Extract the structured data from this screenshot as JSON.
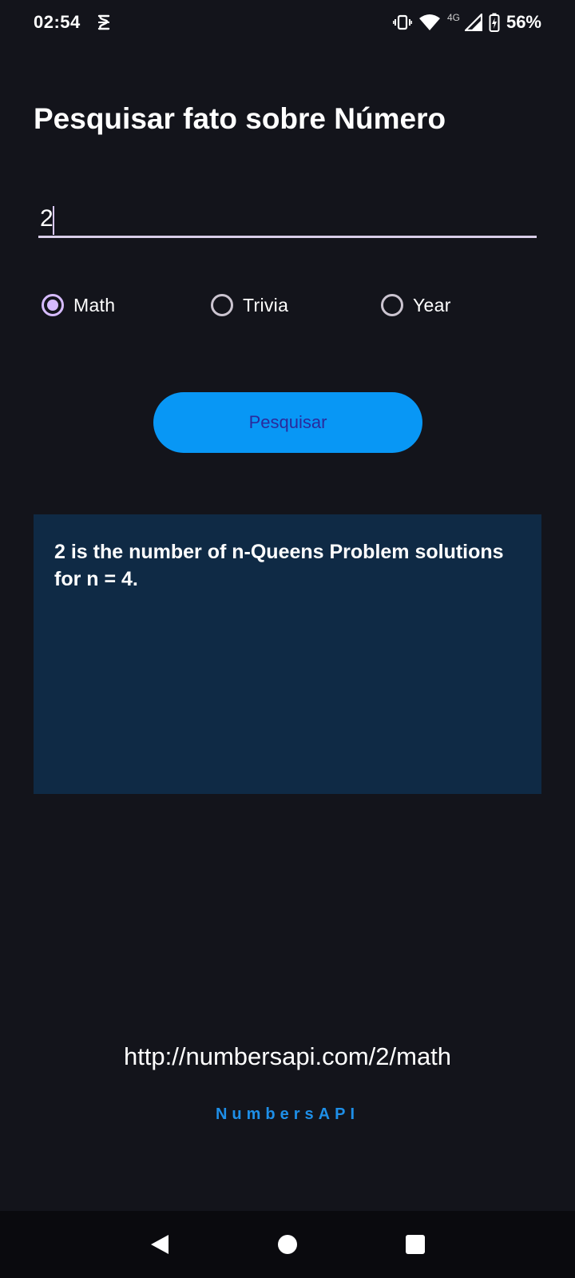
{
  "status_bar": {
    "time": "02:54",
    "network_label": "4G",
    "battery": "56%"
  },
  "title": "Pesquisar fato sobre Número",
  "input": {
    "value": "2",
    "placeholder": ""
  },
  "radios": [
    {
      "label": "Math",
      "checked": true
    },
    {
      "label": "Trivia",
      "checked": false
    },
    {
      "label": "Year",
      "checked": false
    }
  ],
  "search_button_label": "Pesquisar",
  "result_text": "2 is the number of n-Queens Problem solutions for n = 4.",
  "api_url": "http://numbersapi.com/2/math",
  "brand": "NumbersAPI",
  "colors": {
    "background": "#13141b",
    "accent": "#0897f5",
    "card": "#0f2a45",
    "radio_accent": "#d6bbff",
    "brand": "#1e8fe8"
  },
  "icons": [
    "status-app-icon",
    "vibrate-icon",
    "wifi-icon",
    "signal-icon",
    "battery-icon",
    "back-icon",
    "home-icon",
    "recents-icon"
  ]
}
